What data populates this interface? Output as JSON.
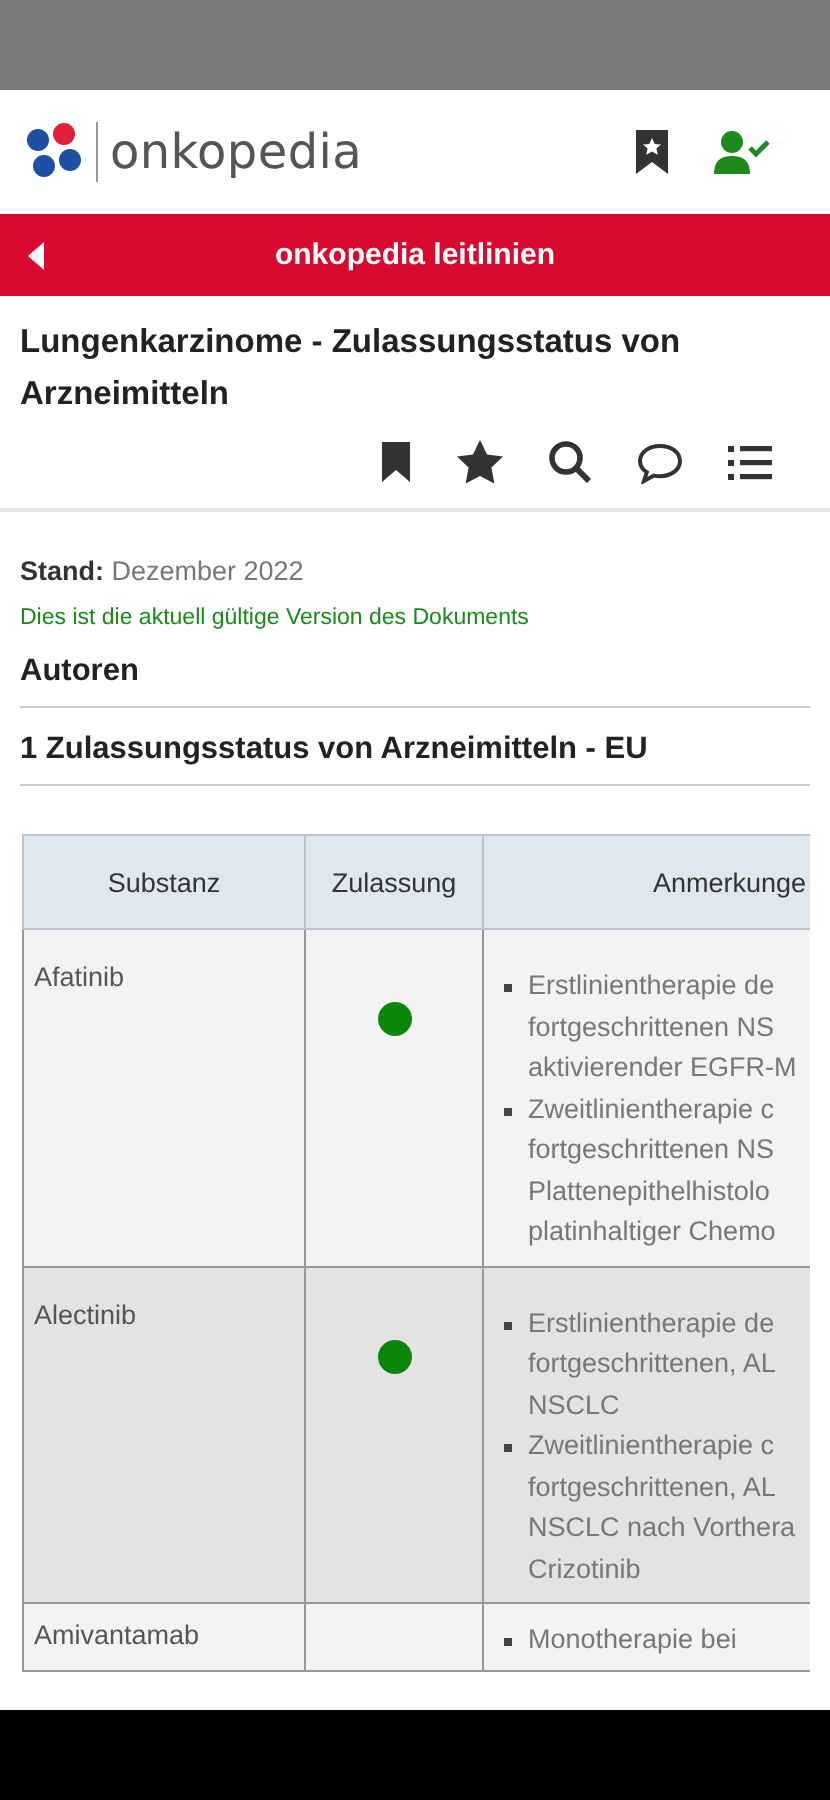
{
  "header": {
    "logo_text": "onkopedia"
  },
  "banner": {
    "title": "onkopedia leitlinien"
  },
  "document": {
    "title": "Lungenkarzinome - Zulassungsstatus von Arzneimitteln",
    "stand_label": "Stand:",
    "stand_value": "Dezember 2022",
    "version_note": "Dies ist die aktuell gültige Version des Dokuments"
  },
  "sections": [
    "Autoren",
    "1  Zulassungsstatus von Arzneimitteln - EU"
  ],
  "table": {
    "columns": [
      "Substanz",
      "Zulassung",
      "Anmerkunge"
    ],
    "rows": [
      {
        "substance": "Afatinib",
        "approved": true,
        "notes": [
          [
            "Erstlinientherapie de",
            "fortgeschrittenen NS",
            "aktivierender EGFR-M"
          ],
          [
            "Zweitlinientherapie c",
            "fortgeschrittenen NS",
            "Plattenepithelhistolo",
            "platinhaltiger Chemo"
          ]
        ]
      },
      {
        "substance": "Alectinib",
        "approved": true,
        "notes": [
          [
            "Erstlinientherapie de",
            "fortgeschrittenen, AL",
            "NSCLC"
          ],
          [
            "Zweitlinientherapie c",
            "fortgeschrittenen, AL",
            "NSCLC nach Vorthera",
            "Crizotinib"
          ]
        ]
      },
      {
        "substance": "Amivantamab",
        "approved": false,
        "notes": [
          [
            "Monotherapie bei"
          ]
        ]
      }
    ]
  }
}
